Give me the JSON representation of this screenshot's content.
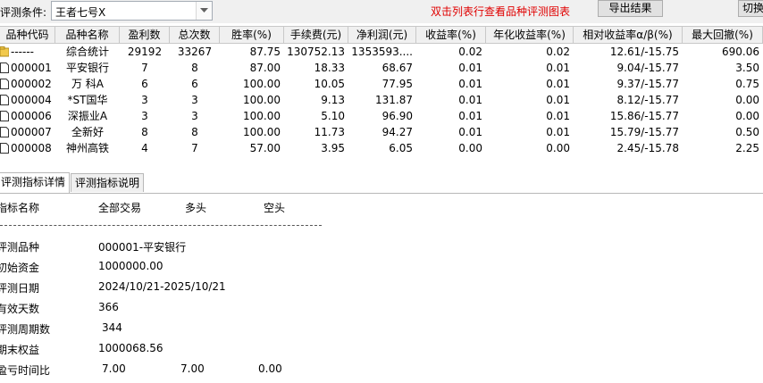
{
  "toolbar": {
    "condition_label": "评测条件:",
    "condition_value": "王者七号X",
    "hint": "双击列表行查看品种评测图表",
    "export_label": "导出结果",
    "switch_label": "切换"
  },
  "table": {
    "headers": [
      "品种代码",
      "品种名称",
      "盈利数",
      "总次数",
      "胜率(%)",
      "手续费(元)",
      "净利润(元)",
      "收益率(%)",
      "年化收益率(%)",
      "相对收益率α/β(%)",
      "最大回撤(%)"
    ],
    "rows": [
      [
        "------",
        "综合统计",
        "29192",
        "33267",
        "87.75",
        "130752.13",
        "1353593....",
        "0.02",
        "0.02",
        "12.61/-15.75",
        "690.06"
      ],
      [
        "000001",
        "平安银行",
        "7",
        "8",
        "87.00",
        "18.33",
        "68.67",
        "0.01",
        "0.01",
        "9.04/-15.77",
        "3.50"
      ],
      [
        "000002",
        "万 科A",
        "6",
        "6",
        "100.00",
        "10.05",
        "77.95",
        "0.01",
        "0.01",
        "9.37/-15.77",
        "0.75"
      ],
      [
        "000004",
        "*ST国华",
        "3",
        "3",
        "100.00",
        "9.13",
        "131.87",
        "0.01",
        "0.01",
        "8.12/-15.77",
        "0.00"
      ],
      [
        "000006",
        "深振业A",
        "3",
        "3",
        "100.00",
        "5.10",
        "96.90",
        "0.01",
        "0.01",
        "15.86/-15.77",
        "0.00"
      ],
      [
        "000007",
        "全新好",
        "8",
        "8",
        "100.00",
        "11.73",
        "94.27",
        "0.01",
        "0.01",
        "15.79/-15.77",
        "0.50"
      ],
      [
        "000008",
        "神州高铁",
        "4",
        "7",
        "57.00",
        "3.95",
        "6.05",
        "0.00",
        "0.00",
        "2.45/-15.78",
        "2.25"
      ]
    ]
  },
  "tabs": [
    "评测指标详情",
    "评测指标说明"
  ],
  "details": {
    "header": [
      "指标名称",
      "全部交易",
      "多头",
      "空头"
    ],
    "items": [
      {
        "label": "评测品种",
        "values": [
          "000001-平安银行"
        ]
      },
      {
        "label": "初始资金",
        "values": [
          "1000000.00"
        ]
      },
      {
        "label": "评测日期",
        "values": [
          "2024/10/21-2025/10/21"
        ]
      },
      {
        "label": "有效天数",
        "values": [
          "366"
        ]
      },
      {
        "label": "评测周期数",
        "values": [
          "344"
        ]
      },
      {
        "label": "期末权益",
        "values": [
          "1000068.56"
        ]
      },
      {
        "label": "盈亏时间比",
        "values": [
          "7.00",
          "7.00",
          "0.00"
        ]
      }
    ]
  }
}
